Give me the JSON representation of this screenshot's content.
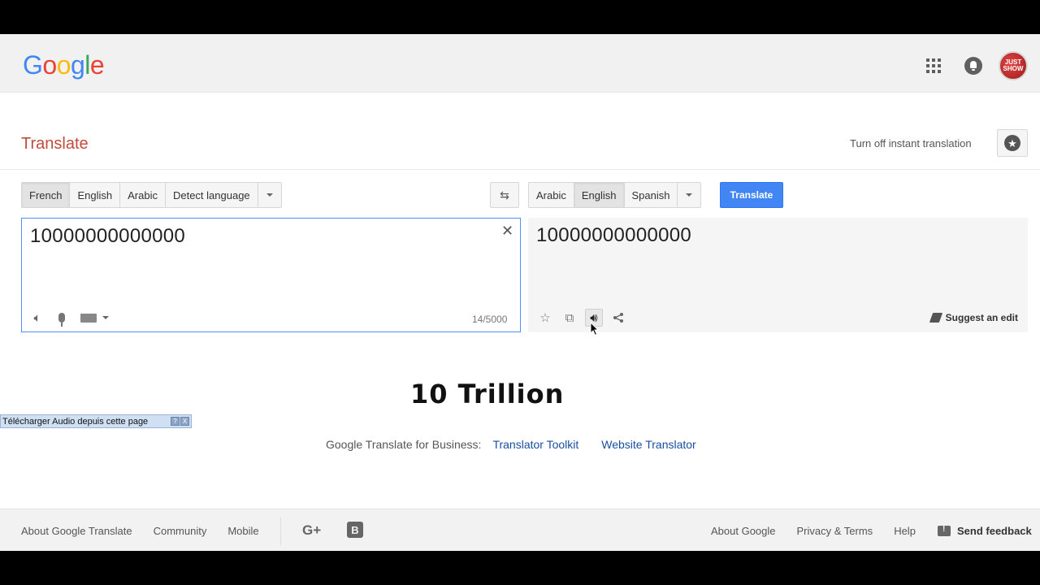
{
  "header": {
    "logo_letters": [
      {
        "ch": "G",
        "color": "#4285f4"
      },
      {
        "ch": "o",
        "color": "#ea4335"
      },
      {
        "ch": "o",
        "color": "#fbbc05"
      },
      {
        "ch": "g",
        "color": "#4285f4"
      },
      {
        "ch": "l",
        "color": "#34a853"
      },
      {
        "ch": "e",
        "color": "#ea4335"
      }
    ],
    "avatar_text": "JUST SHOW"
  },
  "title": "Translate",
  "instant_toggle_label": "Turn off instant translation",
  "source": {
    "languages": [
      "French",
      "English",
      "Arabic",
      "Detect language"
    ],
    "active_language": "French",
    "text": "10000000000000",
    "char_count": "14/5000",
    "clear_symbol": "✕"
  },
  "target": {
    "languages": [
      "Arabic",
      "English",
      "Spanish"
    ],
    "active_language": "English",
    "text": "10000000000000",
    "translate_button": "Translate",
    "suggest_edit": "Suggest an edit"
  },
  "caption": "10 Trillion",
  "download_bar": {
    "label": "Télécharger Audio depuis cette page",
    "help": "?",
    "close": "X"
  },
  "business": {
    "label": "Google Translate for Business:",
    "links": [
      "Translator Toolkit",
      "Website Translator"
    ]
  },
  "footer": {
    "left_links": [
      "About Google Translate",
      "Community",
      "Mobile"
    ],
    "gplus": "G+",
    "blogger": "B",
    "right_links": [
      "About Google",
      "Privacy & Terms",
      "Help"
    ],
    "feedback": "Send feedback"
  },
  "colors": {
    "accent_blue": "#4285f4",
    "title_red": "#c14b3c",
    "link_blue": "#1a4fa0"
  }
}
